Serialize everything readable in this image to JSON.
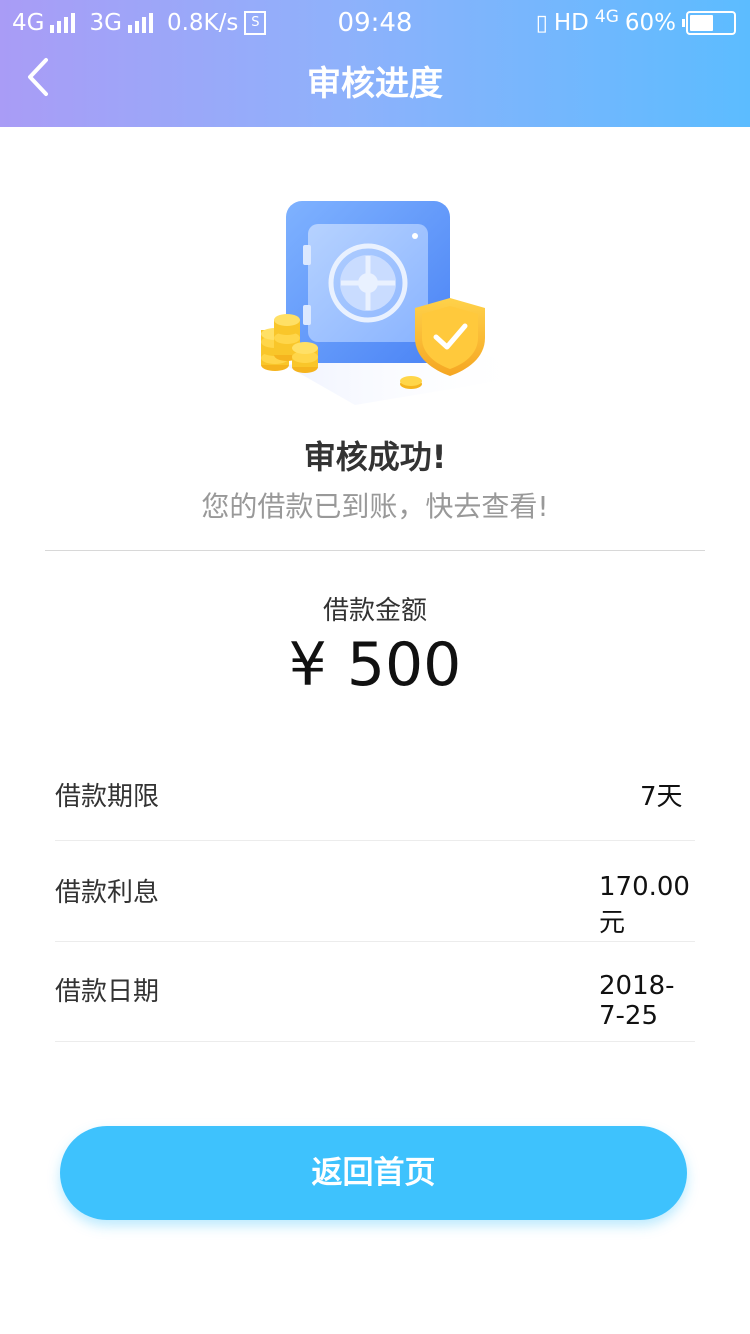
{
  "status_bar": {
    "network1": "4G",
    "network2": "3G",
    "speed": "0.8K/s",
    "sim_label": "S",
    "time": "09:48",
    "hd_label": "HD",
    "network3": "4G",
    "battery": "60%",
    "battery_level": 0.5
  },
  "header": {
    "title": "审核进度",
    "back_icon": "chevron-left-icon"
  },
  "result": {
    "title": "审核成功!",
    "subtitle": "您的借款已到账，快去查看!"
  },
  "amount": {
    "label": "借款金额",
    "currency": "¥",
    "value": "500"
  },
  "details": [
    {
      "label": "借款期限",
      "value": "7天"
    },
    {
      "label": "借款利息",
      "value": "170.00元"
    },
    {
      "label": "借款日期",
      "value": "2018-7-25"
    }
  ],
  "button": {
    "label": "返回首页"
  },
  "colors": {
    "header_gradient_start": "#a99cf6",
    "header_gradient_end": "#5cbcff",
    "button": "#3ec2fd"
  }
}
